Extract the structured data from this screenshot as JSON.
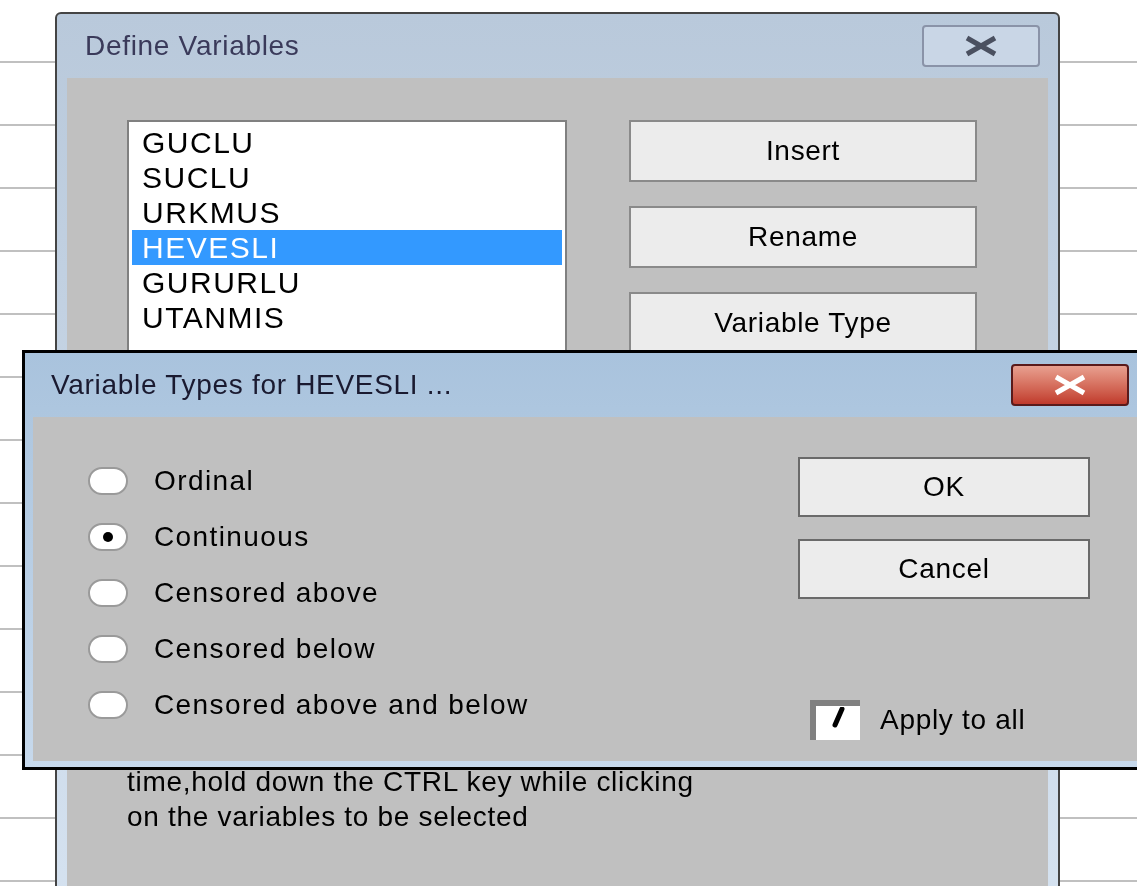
{
  "define_window": {
    "title": "Define Variables",
    "variables": [
      {
        "name": "GUCLU",
        "selected": false
      },
      {
        "name": "SUCLU",
        "selected": false
      },
      {
        "name": "URKMUS",
        "selected": false
      },
      {
        "name": "HEVESLI",
        "selected": true
      },
      {
        "name": "GURURLU",
        "selected": false
      },
      {
        "name": "UTANMIS",
        "selected": false
      }
    ],
    "buttons": [
      "Insert",
      "Rename",
      "Variable Type"
    ],
    "help_lines": [
      "time,hold down the CTRL key while clicking",
      "on the variables to be selected"
    ]
  },
  "types_dialog": {
    "title": "Variable Types for HEVESLI ...",
    "options": [
      {
        "label": "Ordinal",
        "selected": false
      },
      {
        "label": "Continuous",
        "selected": true
      },
      {
        "label": "Censored above",
        "selected": false
      },
      {
        "label": "Censored below",
        "selected": false
      },
      {
        "label": "Censored above and below",
        "selected": false
      }
    ],
    "buttons": [
      "OK",
      "Cancel"
    ],
    "apply_to_all": {
      "label": "Apply to all",
      "checked": true
    }
  }
}
